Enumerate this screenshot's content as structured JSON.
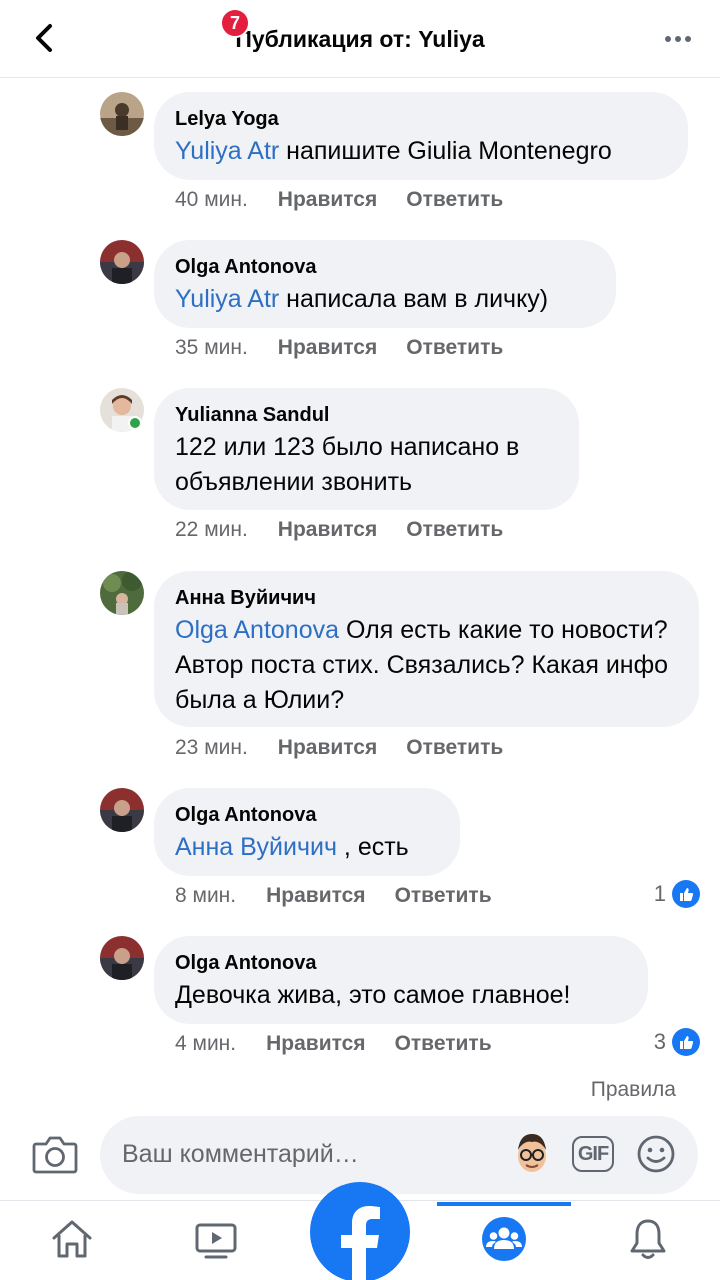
{
  "header": {
    "title": "Публикация от: Yuliya"
  },
  "comments": [
    {
      "author": "Lelya Yoga",
      "mention": "Yuliya Atr",
      "text": " напишите Giulia Montenegro",
      "time": "40 мин.",
      "like": "Нравится",
      "reply": "Ответить"
    },
    {
      "author": "Olga Antonova",
      "mention": "Yuliya Atr",
      "text": " написала вам в личку)",
      "time": "35 мин.",
      "like": "Нравится",
      "reply": "Ответить"
    },
    {
      "author": "Yulianna Sandul",
      "mention": "",
      "text": "122 или 123 было написано в объявлении звонить",
      "time": "22 мин.",
      "like": "Нравится",
      "reply": "Ответить"
    },
    {
      "author": "Анна Вуйичич",
      "mention": "Olga Antonova",
      "text": " Оля есть какие то новости? Автор поста стих. Связались? Какая инфо была а Юлии?",
      "time": "23 мин.",
      "like": "Нравится",
      "reply": "Ответить"
    },
    {
      "author": "Olga Antonova",
      "mention": "Анна Вуйичич",
      "text": " , есть",
      "time": "8 мин.",
      "like": "Нравится",
      "reply": "Ответить",
      "reactions": "1"
    },
    {
      "author": "Olga Antonova",
      "mention": "",
      "text": "Девочка жива, это самое главное!",
      "time": "4 мин.",
      "like": "Нравится",
      "reply": "Ответить",
      "reactions": "3"
    }
  ],
  "composer": {
    "rules_link": "Правила",
    "placeholder": "Ваш комментарий…",
    "gif_label": "GIF"
  },
  "bottom_nav": {
    "items": [
      "home-icon",
      "watch-icon",
      "facebook-logo",
      "groups-icon",
      "notifications-icon"
    ],
    "watch_badge": "7",
    "active": "groups"
  },
  "colors": {
    "accent": "#1877f2",
    "mention": "#2d6fc4",
    "bubble": "#f0f2f5",
    "meta_text": "#65676b",
    "badge": "#e41e3f",
    "online": "#31a24c"
  }
}
